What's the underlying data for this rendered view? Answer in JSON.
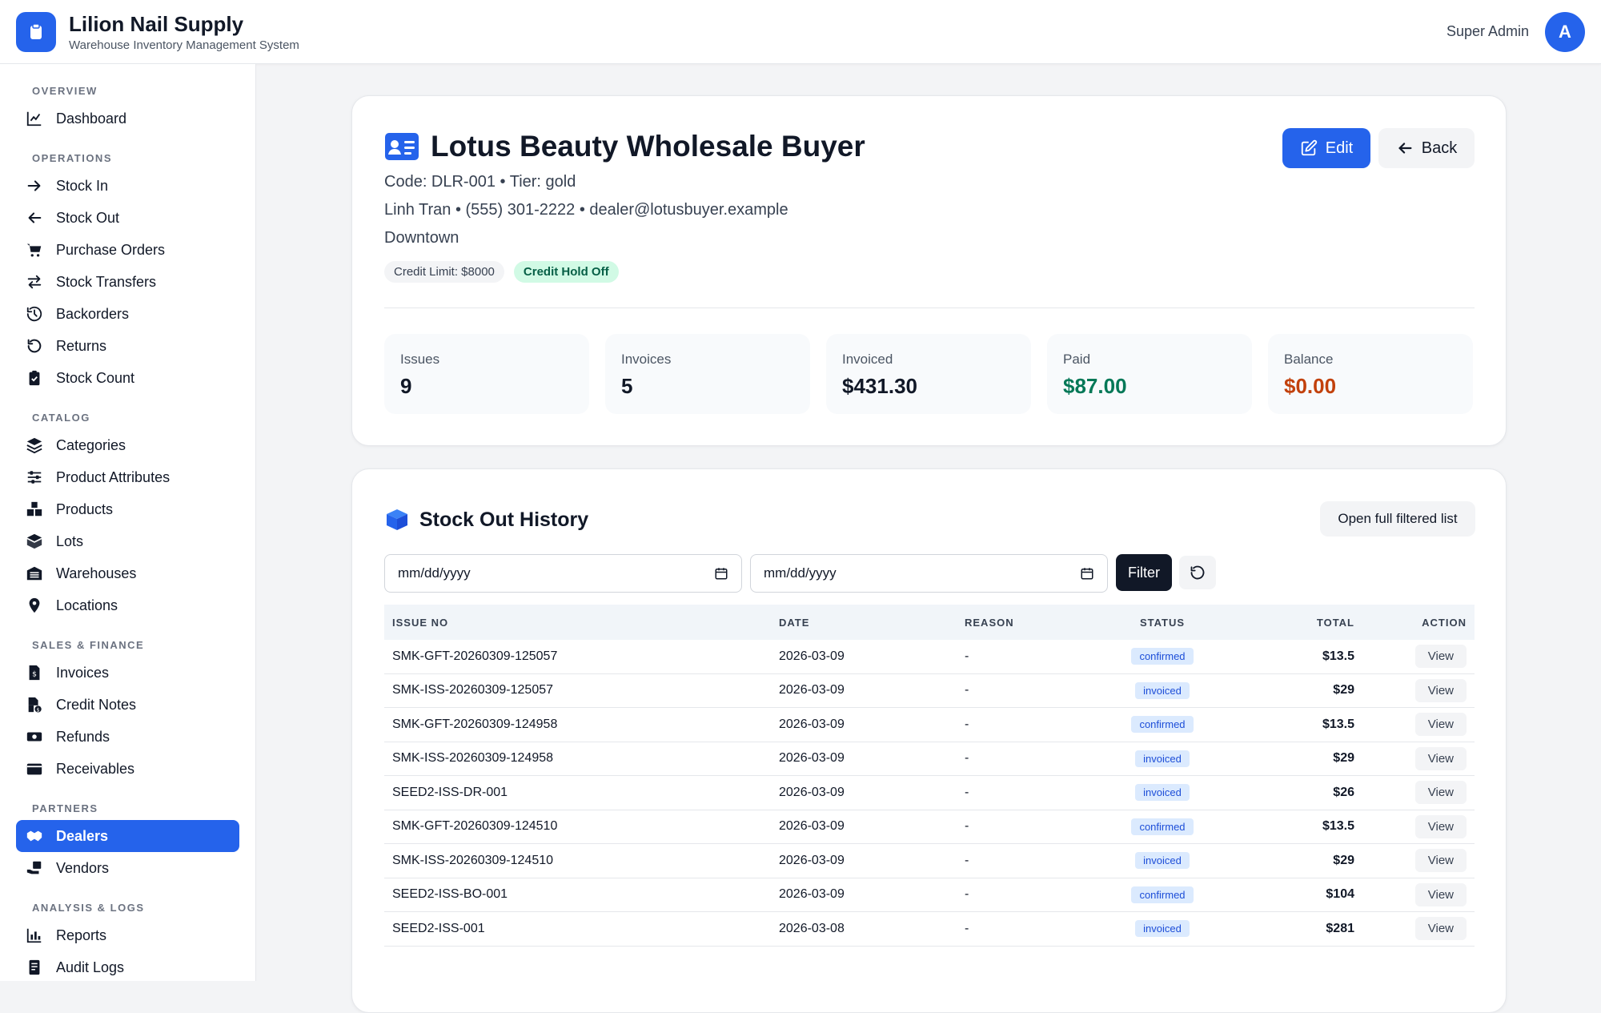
{
  "app": {
    "name": "Lilion Nail Supply",
    "subtitle": "Warehouse Inventory Management System",
    "user_name": "Super Admin",
    "avatar_letter": "A"
  },
  "sidebar": {
    "sections": [
      {
        "title": "OVERVIEW",
        "items": [
          {
            "label": "Dashboard",
            "icon": "chart-icon"
          }
        ]
      },
      {
        "title": "OPERATIONS",
        "items": [
          {
            "label": "Stock In",
            "icon": "arrow-right-icon"
          },
          {
            "label": "Stock Out",
            "icon": "arrow-left-icon"
          },
          {
            "label": "Purchase Orders",
            "icon": "cart-icon"
          },
          {
            "label": "Stock Transfers",
            "icon": "transfer-icon"
          },
          {
            "label": "Backorders",
            "icon": "history-icon"
          },
          {
            "label": "Returns",
            "icon": "undo-icon"
          },
          {
            "label": "Stock Count",
            "icon": "clipboard-check-icon"
          }
        ]
      },
      {
        "title": "CATALOG",
        "items": [
          {
            "label": "Categories",
            "icon": "layers-icon"
          },
          {
            "label": "Product Attributes",
            "icon": "sliders-icon"
          },
          {
            "label": "Products",
            "icon": "boxes-icon"
          },
          {
            "label": "Lots",
            "icon": "box-icon"
          },
          {
            "label": "Warehouses",
            "icon": "warehouse-icon"
          },
          {
            "label": "Locations",
            "icon": "map-pin-icon"
          }
        ]
      },
      {
        "title": "SALES & FINANCE",
        "items": [
          {
            "label": "Invoices",
            "icon": "invoice-icon"
          },
          {
            "label": "Credit Notes",
            "icon": "file-dollar-icon"
          },
          {
            "label": "Refunds",
            "icon": "money-icon"
          },
          {
            "label": "Receivables",
            "icon": "wallet-icon"
          }
        ]
      },
      {
        "title": "PARTNERS",
        "items": [
          {
            "label": "Dealers",
            "icon": "handshake-icon",
            "active": true
          },
          {
            "label": "Vendors",
            "icon": "truck-hand-icon"
          }
        ]
      },
      {
        "title": "ANALYSIS & LOGS",
        "items": [
          {
            "label": "Reports",
            "icon": "bar-chart-icon"
          },
          {
            "label": "Audit Logs",
            "icon": "log-icon"
          }
        ]
      }
    ]
  },
  "dealer": {
    "icon": "id-card-icon",
    "name": "Lotus Beauty Wholesale Buyer",
    "code_line": "Code: DLR-001 • Tier: gold",
    "contact_line": "Linh Tran • (555) 301-2222 • dealer@lotusbuyer.example",
    "area": "Downtown",
    "credit_limit": "Credit Limit: $8000",
    "credit_hold": "Credit Hold Off",
    "edit_label": "Edit",
    "back_label": "Back"
  },
  "stats": [
    {
      "label": "Issues",
      "value": "9",
      "tone": "default"
    },
    {
      "label": "Invoices",
      "value": "5",
      "tone": "default"
    },
    {
      "label": "Invoiced",
      "value": "$431.30",
      "tone": "default"
    },
    {
      "label": "Paid",
      "value": "$87.00",
      "tone": "green"
    },
    {
      "label": "Balance",
      "value": "$0.00",
      "tone": "orange"
    }
  ],
  "history": {
    "icon": "box-icon",
    "title": "Stock Out History",
    "open_full_label": "Open full filtered list",
    "date_from_placeholder": "mm/dd/yyyy",
    "date_to_placeholder": "mm/dd/yyyy",
    "filter_label": "Filter",
    "columns": [
      "ISSUE NO",
      "DATE",
      "REASON",
      "STATUS",
      "TOTAL",
      "ACTION"
    ],
    "rows": [
      {
        "issue_no": "SMK-GFT-20260309-125057",
        "date": "2026-03-09",
        "reason": "-",
        "status": "confirmed",
        "total": "$13.5",
        "action": "View"
      },
      {
        "issue_no": "SMK-ISS-20260309-125057",
        "date": "2026-03-09",
        "reason": "-",
        "status": "invoiced",
        "total": "$29",
        "action": "View"
      },
      {
        "issue_no": "SMK-GFT-20260309-124958",
        "date": "2026-03-09",
        "reason": "-",
        "status": "confirmed",
        "total": "$13.5",
        "action": "View"
      },
      {
        "issue_no": "SMK-ISS-20260309-124958",
        "date": "2026-03-09",
        "reason": "-",
        "status": "invoiced",
        "total": "$29",
        "action": "View"
      },
      {
        "issue_no": "SEED2-ISS-DR-001",
        "date": "2026-03-09",
        "reason": "-",
        "status": "invoiced",
        "total": "$26",
        "action": "View"
      },
      {
        "issue_no": "SMK-GFT-20260309-124510",
        "date": "2026-03-09",
        "reason": "-",
        "status": "confirmed",
        "total": "$13.5",
        "action": "View"
      },
      {
        "issue_no": "SMK-ISS-20260309-124510",
        "date": "2026-03-09",
        "reason": "-",
        "status": "invoiced",
        "total": "$29",
        "action": "View"
      },
      {
        "issue_no": "SEED2-ISS-BO-001",
        "date": "2026-03-09",
        "reason": "-",
        "status": "confirmed",
        "total": "$104",
        "action": "View"
      },
      {
        "issue_no": "SEED2-ISS-001",
        "date": "2026-03-08",
        "reason": "-",
        "status": "invoiced",
        "total": "$281",
        "action": "View"
      }
    ]
  },
  "colors": {
    "primary": "#2563eb",
    "paid": "#047857",
    "balance": "#c2410c",
    "dark_button": "#111827"
  }
}
